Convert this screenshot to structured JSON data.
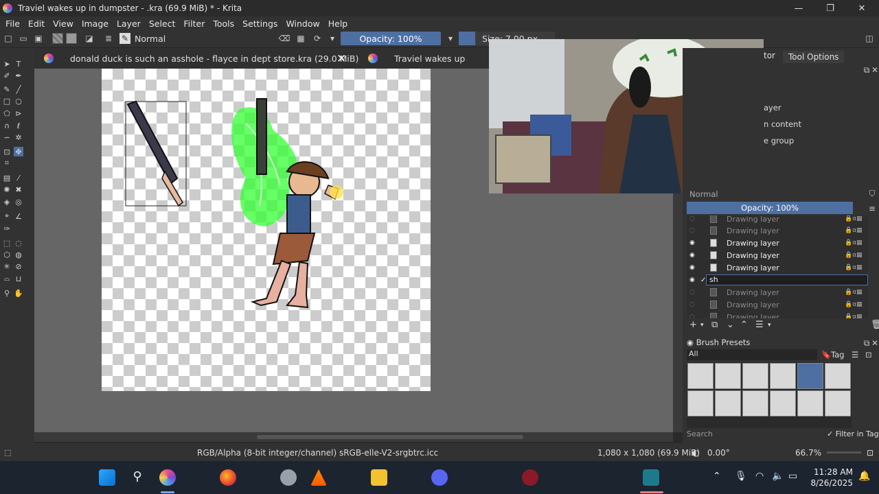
{
  "window": {
    "title": "Traviel wakes up in dumpster - .kra (69.9 MiB) * - Krita",
    "minimize": "—",
    "maximize": "❐",
    "close": "✕"
  },
  "menu": [
    "File",
    "Edit",
    "View",
    "Image",
    "Layer",
    "Select",
    "Filter",
    "Tools",
    "Settings",
    "Window",
    "Help"
  ],
  "toolbar": {
    "blend_mode": "Normal",
    "opacity": "Opacity: 100%",
    "size": "Size: 7.00 px"
  },
  "tabs": [
    {
      "label": "donald duck is such an asshole - flayce in dept store.kra (29.0 MiB)",
      "close": "✕"
    },
    {
      "label": "Traviel wakes up"
    }
  ],
  "docker": {
    "tab_partial": "tor",
    "tab_active": "Tool Options",
    "tool_options_lines": [
      "ayer",
      "n content",
      "e group"
    ],
    "layer_blend": "Normal",
    "layer_opacity": "Opacity: 100%",
    "layers": [
      {
        "name": "Drawing layer",
        "visible": false
      },
      {
        "name": "Drawing layer",
        "visible": false
      },
      {
        "name": "Drawing layer",
        "visible": true
      },
      {
        "name": "Drawing layer",
        "visible": true
      },
      {
        "name": "Drawing layer",
        "visible": true
      },
      {
        "name": "sh",
        "visible": true,
        "editing": true
      },
      {
        "name": "Drawing layer",
        "visible": false
      },
      {
        "name": "Drawing layer",
        "visible": false
      },
      {
        "name": "Drawing layer",
        "visible": false
      }
    ],
    "brush_presets_title": "Brush Presets",
    "brush_filter": "All",
    "tag_label": "Tag",
    "search_placeholder": "Search",
    "filter_in_tag": "Filter in Tag"
  },
  "status": {
    "color_profile": "RGB/Alpha (8-bit integer/channel)  sRGB-elle-V2-srgbtrc.icc",
    "dimensions": "1,080 x 1,080 (69.9 MiB)",
    "rotation": "0.00°",
    "zoom": "66.7%"
  },
  "taskbar": {
    "time": "11:28 AM",
    "date": "8/26/2025"
  },
  "colors": {
    "accent": "#4e6fa1",
    "panel": "#323232",
    "canvas_bg": "#666666"
  }
}
